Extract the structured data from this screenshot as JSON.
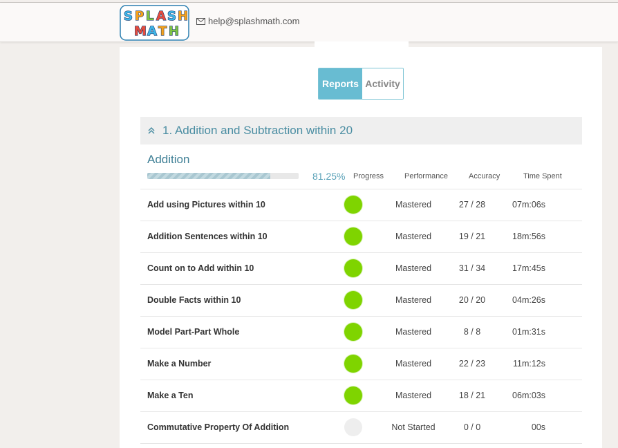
{
  "header": {
    "logo_text": "SPLASH MATH",
    "email": "help@splashmath.com"
  },
  "tabs": [
    {
      "label": "Reports",
      "active": true
    },
    {
      "label": "Activity",
      "active": false
    }
  ],
  "section": {
    "title": "1.  Addition and Subtraction within 20"
  },
  "subtopic": {
    "title": "Addition",
    "progress_percent": 81.25,
    "progress_label": "81.25%"
  },
  "columns": {
    "progress": "Progress",
    "performance": "Performance",
    "accuracy": "Accuracy",
    "time_spent": "Time Spent"
  },
  "colors": {
    "mastered": "#7fd400",
    "not_started": "#eeeeee",
    "accent": "#68bcd2"
  },
  "rows": [
    {
      "skill": "Add using Pictures within 10",
      "status": "mastered",
      "performance": "Mastered",
      "accuracy": "27 / 28",
      "time": "07m:06s"
    },
    {
      "skill": "Addition Sentences within 10",
      "status": "mastered",
      "performance": "Mastered",
      "accuracy": "19 / 21",
      "time": "18m:56s"
    },
    {
      "skill": "Count on to Add within 10",
      "status": "mastered",
      "performance": "Mastered",
      "accuracy": "31 / 34",
      "time": "17m:45s"
    },
    {
      "skill": "Double Facts within 10",
      "status": "mastered",
      "performance": "Mastered",
      "accuracy": "20 / 20",
      "time": "04m:26s"
    },
    {
      "skill": "Model Part-Part Whole",
      "status": "mastered",
      "performance": "Mastered",
      "accuracy": "8 / 8",
      "time": "01m:31s"
    },
    {
      "skill": "Make a Number",
      "status": "mastered",
      "performance": "Mastered",
      "accuracy": "22 / 23",
      "time": "11m:12s"
    },
    {
      "skill": "Make a Ten",
      "status": "mastered",
      "performance": "Mastered",
      "accuracy": "18 / 21",
      "time": "06m:03s"
    },
    {
      "skill": "Commutative Property Of Addition",
      "status": "not_started",
      "performance": "Not Started",
      "accuracy": "0 / 0",
      "time": "00s"
    }
  ]
}
